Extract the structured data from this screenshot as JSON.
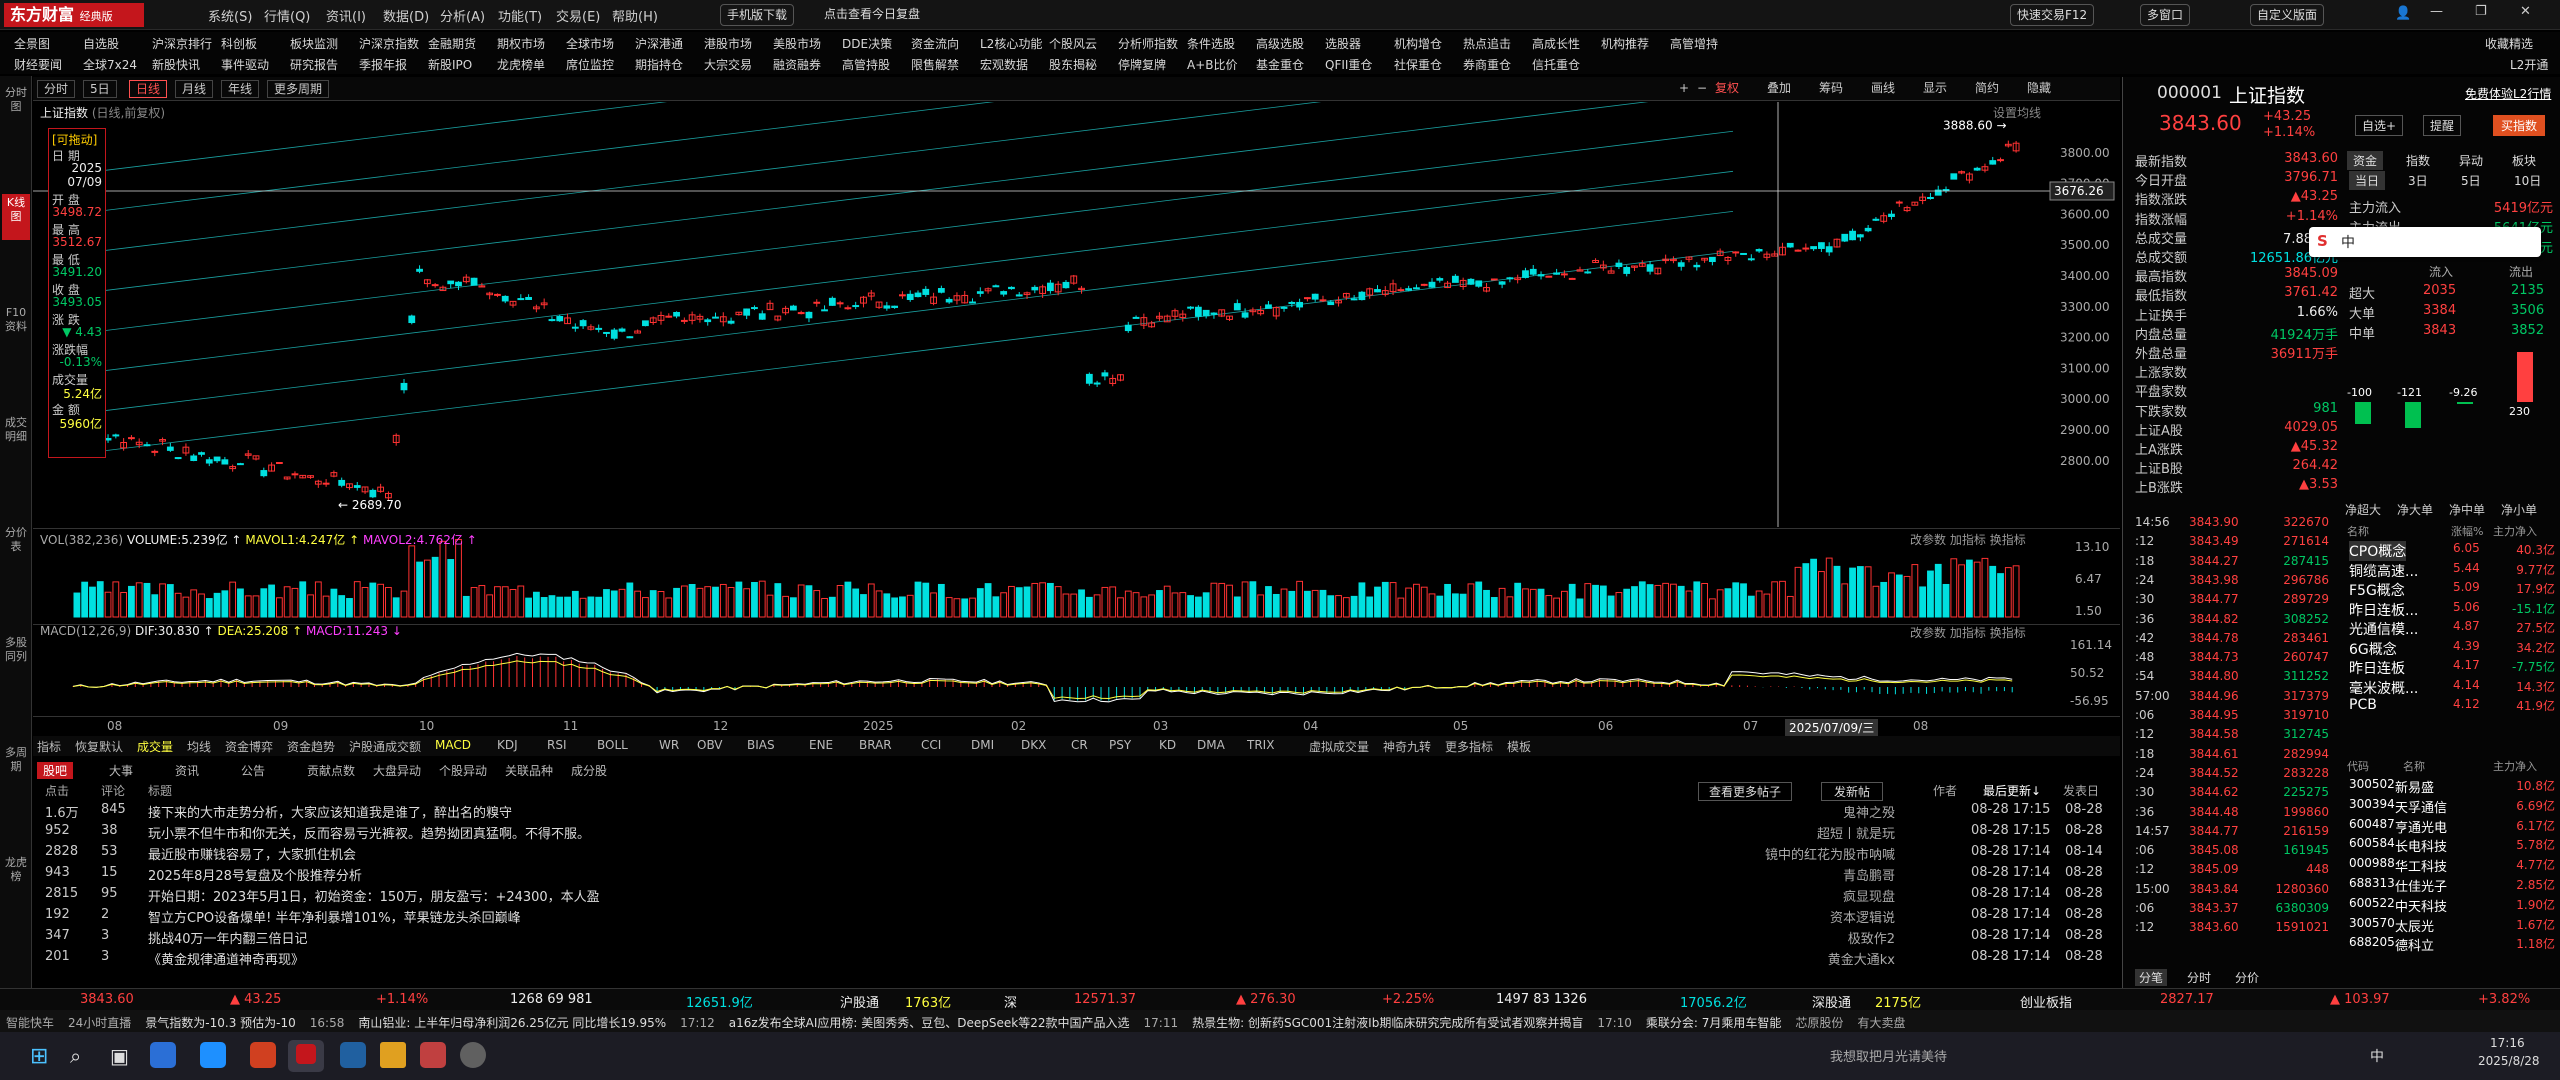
{
  "app": {
    "logo": "东方财富",
    "edition": "经典版"
  },
  "menu": [
    "系统(S)",
    "行情(Q)",
    "资讯(I)",
    "数据(D)",
    "分析(A)",
    "功能(T)",
    "交易(E)",
    "帮助(H)"
  ],
  "topbar": {
    "mobile": "手机版下载",
    "review": "点击查看今日复盘",
    "fast_trade": "快速交易F12",
    "multi_window": "多窗口",
    "custom_layout": "自定义版面"
  },
  "nav_row1": [
    "全景图",
    "自选股",
    "沪深京排行",
    "科创板",
    "板块监测",
    "沪深京指数",
    "金融期货",
    "期权市场",
    "全球市场",
    "沪深港通",
    "港股市场",
    "美股市场",
    "DDE决策",
    "资金流向",
    "L2核心功能",
    "个股风云",
    "分析师指数",
    "条件选股",
    "高级选股",
    "选股器",
    "机构增仓",
    "热点追击",
    "高成长性",
    "机构推荐",
    "高管增持"
  ],
  "nav_row2": [
    "财经要闻",
    "全球7x24",
    "新股快讯",
    "事件驱动",
    "研究报告",
    "季报年报",
    "新股IPO",
    "龙虎榜单",
    "席位监控",
    "期指持仓",
    "大宗交易",
    "融资融券",
    "高管持股",
    "限售解禁",
    "宏观数据",
    "股东揭秘",
    "停牌复牌",
    "A+B比价",
    "基金重仓",
    "QFII重仓",
    "社保重仓",
    "券商重仓",
    "信托重仓"
  ],
  "nav_right": {
    "favorites": "收藏精选",
    "l2": "L2开通"
  },
  "left_strip": [
    "分时图",
    "K线图",
    "F10资料",
    "成交明细",
    "分价表",
    "多股同列",
    "多周期",
    "龙虎榜"
  ],
  "left_active": "K线图",
  "period_tabs": [
    "分时",
    "5日",
    "日线",
    "月线",
    "年线",
    "更多周期"
  ],
  "period_active": "日线",
  "chart_toolbar_right": [
    "复权",
    "叠加",
    "筹码",
    "画线",
    "显示",
    "简约",
    "隐藏"
  ],
  "chart": {
    "title": "上证指数",
    "subtitle": "(日线,前复权)",
    "settings": "设置均线",
    "price_labels": [
      "3800.00",
      "3700.00",
      "3600.00",
      "3500.00",
      "3400.00",
      "3300.00",
      "3200.00",
      "3100.00",
      "3000.00",
      "2900.00",
      "2800.00"
    ],
    "cross_price": "3676.26",
    "high_mark": "3888.60",
    "low_mark": "2689.70"
  },
  "info_panel": {
    "title": "[可拖动]",
    "date_label": "日 期",
    "date_year": "2025",
    "date_md": "07/09",
    "open_label": "开 盘",
    "open": "3498.72",
    "high_label": "最 高",
    "high": "3512.67",
    "low_label": "最 低",
    "low": "3491.20",
    "close_label": "收 盘",
    "close": "3493.05",
    "chg_label": "涨 跌",
    "chg": "▼ 4.43",
    "pct_label": "涨跌幅",
    "pct": "-0.13%",
    "vol_label": "成交量",
    "vol": "5.24亿",
    "amt_label": "金 额",
    "amt": "5960亿"
  },
  "volume": {
    "label": "VOL(382,236)",
    "v": "VOLUME:5.239亿 ↑",
    "ma1": "MAVOL1:4.247亿 ↑",
    "ma2": "MAVOL2:4.762亿 ↑",
    "right": [
      "改参数",
      "加指标",
      "换指标"
    ],
    "ticks": [
      "13.10",
      "6.47",
      "1.50"
    ]
  },
  "macd": {
    "label": "MACD(12,26,9)",
    "dif": "DIF:30.830 ↑",
    "dea": "DEA:25.208 ↑",
    "macd": "MACD:11.243 ↓",
    "right": [
      "改参数",
      "加指标",
      "换指标"
    ],
    "ticks": [
      "161.14",
      "50.52",
      "-56.95"
    ]
  },
  "xaxis": [
    "08",
    "09",
    "10",
    "11",
    "12",
    "2025",
    "02",
    "03",
    "04",
    "05",
    "06",
    "07",
    "2025/07/09/三",
    "08"
  ],
  "indicator_tabs": [
    "指标",
    "恢复默认",
    "成交量",
    "均线",
    "资金博弈",
    "资金趋势",
    "沪股通成交额",
    "MACD",
    "KDJ",
    "RSI",
    "BOLL",
    "WR",
    "OBV",
    "BIAS",
    "ENE",
    "BRAR",
    "CCI",
    "DMI",
    "DKX",
    "CR",
    "PSY",
    "KD",
    "DMA",
    "TRIX",
    "虚拟成交量",
    "神奇九转",
    "更多指标",
    "模板"
  ],
  "guba": {
    "tabs": [
      "股吧",
      "大事",
      "资讯",
      "公告",
      "贡献点数",
      "大盘异动",
      "个股异动",
      "关联品种",
      "成分股"
    ],
    "header": {
      "clicks": "点击",
      "comments": "评论",
      "title": "标题",
      "more": "查看更多帖子",
      "post": "发新帖",
      "author": "作者",
      "updated": "最后更新↓",
      "posted": "发表日"
    },
    "rows": [
      {
        "c": "1.6万",
        "r": "845",
        "t": "接下来的大市走势分析，大家应该知道我是谁了，醉出名的糗守",
        "a": "鬼神之殁",
        "u": "08-28 17:15",
        "p": "08-28"
      },
      {
        "c": "952",
        "r": "38",
        "t": "玩小票不但牛市和你无关，反而容易亏光裤衩。趋势拗团真猛啊。不得不服。",
        "a": "超短丨就是玩",
        "u": "08-28 17:15",
        "p": "08-28"
      },
      {
        "c": "2828",
        "r": "53",
        "t": "最近股市赚钱容易了，大家抓住机会",
        "a": "镜中的红花为股市呐喊",
        "u": "08-28 17:14",
        "p": "08-14"
      },
      {
        "c": "943",
        "r": "15",
        "t": "2025年8月28号复盘及个股推荐分析",
        "a": "青岛鹏哥",
        "u": "08-28 17:14",
        "p": "08-28"
      },
      {
        "c": "2815",
        "r": "95",
        "t": "开始日期：2023年5月1日，初始资金：150万，朋友盈亏：+24300，本人盈",
        "a": "疯显现盘",
        "u": "08-28 17:14",
        "p": "08-28"
      },
      {
        "c": "192",
        "r": "2",
        "t": "智立方CPO设备爆单! 半年净利暴增101%，苹果链龙头杀回巅峰",
        "a": "资本逻辑说",
        "u": "08-28 17:14",
        "p": "08-28"
      },
      {
        "c": "347",
        "r": "3",
        "t": "挑战40万一年内翻三倍日记",
        "a": "极致作2",
        "u": "08-28 17:14",
        "p": "08-28"
      },
      {
        "c": "201",
        "r": "3",
        "t": "《黄金规律通道神奇再现》",
        "a": "黄金大通kx",
        "u": "08-28 17:14",
        "p": "08-28"
      }
    ]
  },
  "rightpanel": {
    "code": "000001",
    "name": "上证指数",
    "price": "3843.60",
    "chg": "+43.25",
    "pct": "+1.14%",
    "free_l2": "免费体验L2行情",
    "self": "自选+",
    "alert": "提醒",
    "buy_index": "买指数",
    "stats": [
      {
        "k": "最新指数",
        "v": "3843.60",
        "c": "red"
      },
      {
        "k": "今日开盘",
        "v": "3796.71",
        "c": "red"
      },
      {
        "k": "指数涨跌",
        "v": "▲43.25",
        "c": "red"
      },
      {
        "k": "指数涨幅",
        "v": "+1.14%",
        "c": "red"
      },
      {
        "k": "总成交量",
        "v": "7.88亿手",
        "c": "white"
      },
      {
        "k": "总成交额",
        "v": "12651.86亿元",
        "c": "cyan"
      },
      {
        "k": "最高指数",
        "v": "3845.09",
        "c": "red"
      },
      {
        "k": "最低指数",
        "v": "3761.42",
        "c": "red"
      },
      {
        "k": "上证换手",
        "v": "1.66%",
        "c": "white"
      },
      {
        "k": "内盘总量",
        "v": "41924万手",
        "c": "green"
      },
      {
        "k": "外盘总量",
        "v": "36911万手",
        "c": "red"
      },
      {
        "k": "上涨家数",
        "v": "",
        "c": "red"
      },
      {
        "k": "平盘家数",
        "v": "",
        "c": "white"
      },
      {
        "k": "下跌家数",
        "v": "981",
        "c": "green"
      },
      {
        "k": "上证A股",
        "v": "4029.05",
        "c": "red"
      },
      {
        "k": "上A涨跌",
        "v": "▲45.32",
        "c": "red"
      },
      {
        "k": "上证B股",
        "v": "264.42",
        "c": "red"
      },
      {
        "k": "上B涨跌",
        "v": "▲3.53",
        "c": "red"
      }
    ],
    "tabs": [
      "资金",
      "指数",
      "异动",
      "板块"
    ],
    "subtabs": [
      "当日",
      "3日",
      "5日",
      "10日"
    ],
    "flows": [
      {
        "k": "主力流入",
        "v": "5419亿元",
        "c": "red"
      },
      {
        "k": "主力流出",
        "v": "5641亿元",
        "c": "green"
      },
      {
        "k": "主力净流入",
        "v": "-221亿元",
        "c": "green"
      }
    ],
    "flow_head": [
      "",
      "流入",
      "流出"
    ],
    "flow_rows": [
      {
        "k": "超大",
        "i": "2035",
        "o": "2135"
      },
      {
        "k": "大单",
        "i": "3384",
        "o": "3506"
      },
      {
        "k": "中单",
        "i": "3843",
        "o": "3852"
      }
    ],
    "net_bars": [
      "-100",
      "-121",
      "-9.26",
      "230"
    ],
    "net_labels": [
      "净超大",
      "净大单",
      "净中单",
      "净小单"
    ],
    "ticks": [
      {
        "t": "14:56",
        "p": "3843.90",
        "v": "322670"
      },
      {
        "t": ":12",
        "p": "3843.49",
        "v": "271614"
      },
      {
        "t": ":18",
        "p": "3844.27",
        "v": "287415"
      },
      {
        "t": ":24",
        "p": "3843.98",
        "v": "296786"
      },
      {
        "t": ":30",
        "p": "3844.77",
        "v": "289729"
      },
      {
        "t": ":36",
        "p": "3844.82",
        "v": "308252"
      },
      {
        "t": ":42",
        "p": "3844.78",
        "v": "283461"
      },
      {
        "t": ":48",
        "p": "3844.73",
        "v": "260747"
      },
      {
        "t": ":54",
        "p": "3844.80",
        "v": "311252"
      },
      {
        "t": "57:00",
        "p": "3844.96",
        "v": "317379"
      },
      {
        "t": ":06",
        "p": "3844.95",
        "v": "319710"
      },
      {
        "t": ":12",
        "p": "3844.58",
        "v": "312745"
      },
      {
        "t": ":18",
        "p": "3844.61",
        "v": "282994"
      },
      {
        "t": ":24",
        "p": "3844.52",
        "v": "283228"
      },
      {
        "t": ":30",
        "p": "3844.62",
        "v": "225275"
      },
      {
        "t": ":36",
        "p": "3844.48",
        "v": "199860"
      },
      {
        "t": "14:57",
        "p": "3844.77",
        "v": "216159"
      },
      {
        "t": ":06",
        "p": "3845.08",
        "v": "161945"
      },
      {
        "t": ":12",
        "p": "3845.09",
        "v": "448"
      },
      {
        "t": "15:00",
        "p": "3843.84",
        "v": "1280360"
      },
      {
        "t": ":06",
        "p": "3843.37",
        "v": "6380309"
      },
      {
        "t": ":12",
        "p": "3843.60",
        "v": "1591021"
      }
    ],
    "sector_head": [
      "名称",
      "涨幅%",
      "主力净入"
    ],
    "sectors": [
      {
        "n": "CPO概念",
        "p": "6.05",
        "m": "40.3亿"
      },
      {
        "n": "铜缆高速...",
        "p": "5.44",
        "m": "9.77亿"
      },
      {
        "n": "F5G概念",
        "p": "5.09",
        "m": "17.9亿"
      },
      {
        "n": "昨日连板...",
        "p": "5.06",
        "m": "-15.1亿"
      },
      {
        "n": "光通信模...",
        "p": "4.87",
        "m": "27.5亿"
      },
      {
        "n": "6G概念",
        "p": "4.39",
        "m": "34.2亿"
      },
      {
        "n": "昨日连板",
        "p": "4.17",
        "m": "-7.75亿"
      },
      {
        "n": "毫米波概...",
        "p": "4.14",
        "m": "14.3亿"
      },
      {
        "n": "PCB",
        "p": "4.12",
        "m": "41.9亿"
      }
    ],
    "stock_head": [
      "代码",
      "名称",
      "主力净入"
    ],
    "stocks": [
      {
        "c": "300502",
        "n": "新易盛",
        "m": "10.8亿"
      },
      {
        "c": "300394",
        "n": "天孚通信",
        "m": "6.69亿"
      },
      {
        "c": "600487",
        "n": "亨通光电",
        "m": "6.17亿"
      },
      {
        "c": "600584",
        "n": "长电科技",
        "m": "5.78亿"
      },
      {
        "c": "000988",
        "n": "华工科技",
        "m": "4.77亿"
      },
      {
        "c": "688313",
        "n": "仕佳光子",
        "m": "2.85亿"
      },
      {
        "c": "600522",
        "n": "中天科技",
        "m": "1.90亿"
      },
      {
        "c": "300570",
        "n": "太辰光",
        "m": "1.67亿"
      },
      {
        "c": "688205",
        "n": "德科立",
        "m": "1.18亿"
      }
    ],
    "bottom_tabs": [
      "分笔",
      "分时",
      "分价"
    ]
  },
  "status": {
    "sh": "3843.60",
    "sh_chg": "▲ 43.25",
    "sh_pct": "+1.14%",
    "sh_cnt": "1268 69 981",
    "sh_amt": "12651.9亿",
    "hgt": "沪股通",
    "hgt_v": "1763亿",
    "sz_label": "深",
    "sz": "12571.37",
    "sz_chg": "▲ 276.30",
    "sz_pct": "+2.25%",
    "sz_cnt": "1497 83 1326",
    "sz_amt": "17056.2亿",
    "sgt": "深股通",
    "sgt_v": "2175亿",
    "cyb": "创业板指",
    "cyb_v": "2827.17",
    "cyb_chg": "▲ 103.97",
    "cyb_pct": "+3.82%"
  },
  "news": [
    "智能快车",
    "24小时直播",
    "景气指数为-10.3 预估为-10",
    "16:58",
    "南山铝业: 上半年归母净利润26.25亿元 同比增长19.95%",
    "17:12",
    "a16z发布全球AI应用榜: 美图秀秀、豆包、DeepSeek等22款中国产品入选",
    "17:11",
    "热景生物: 创新药SGC001注射液Ib期临床研究完成所有受试者观察并揭盲",
    "17:10",
    "乘联分会: 7月乘用车智能",
    "芯原股份",
    "有大卖盘"
  ],
  "taskbar": {
    "search_hint": "我想取把月光请美待",
    "time": "17:16",
    "date": "2025/8/28",
    "ime": "中"
  }
}
